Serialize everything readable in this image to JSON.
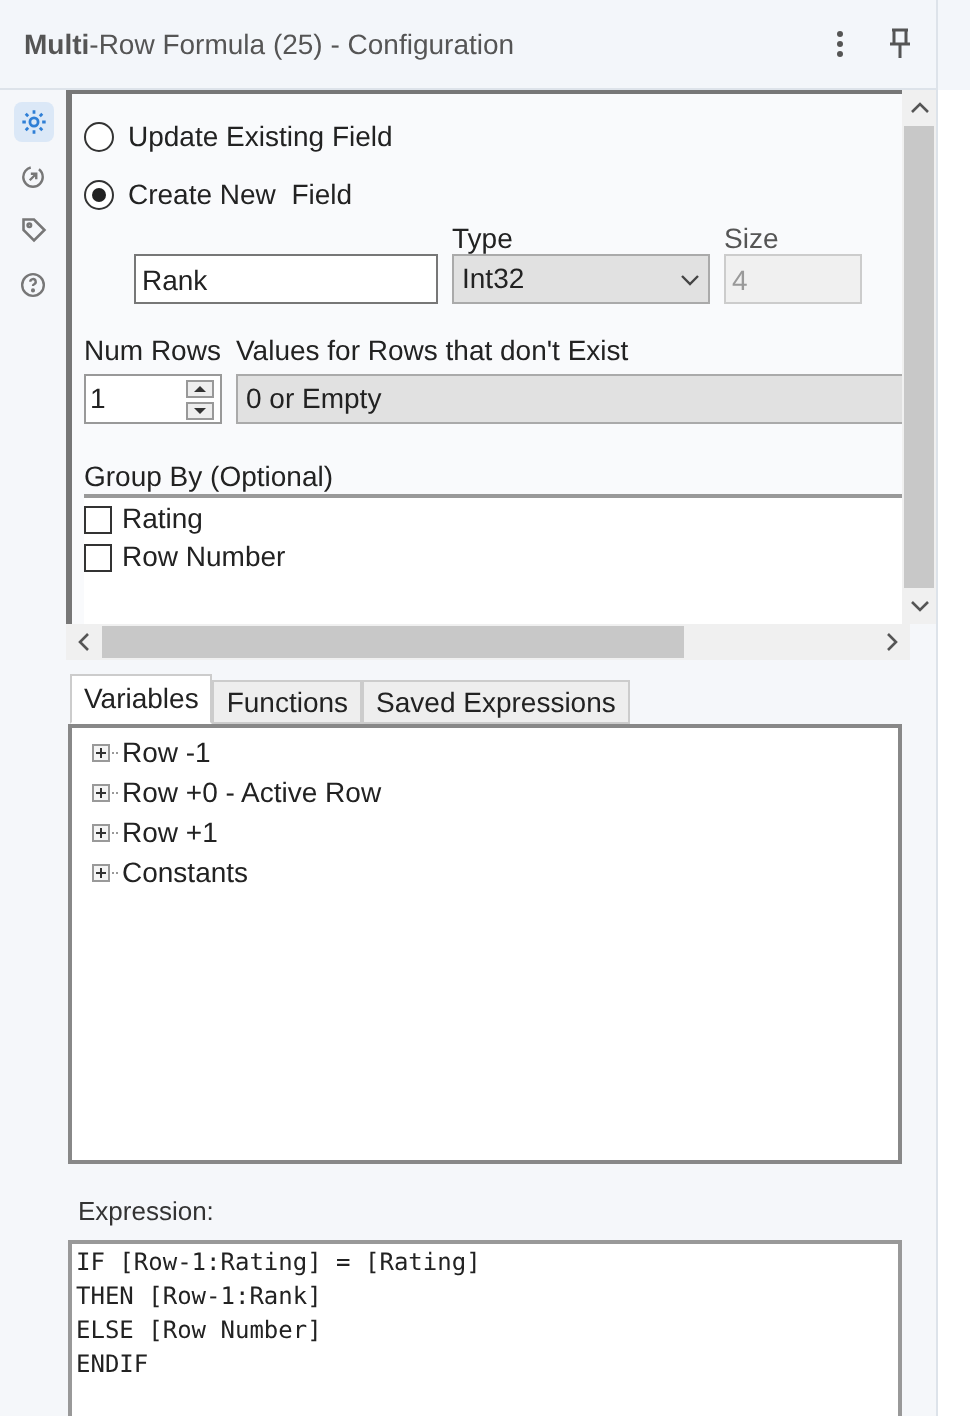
{
  "title": "**Multi**-Row Formula (25) - Configuration",
  "sidebar": {
    "items": [
      {
        "kind": "settings",
        "selected": true
      },
      {
        "kind": "connection",
        "selected": false
      },
      {
        "kind": "tag",
        "selected": false
      },
      {
        "kind": "help",
        "selected": false
      }
    ]
  },
  "mode_options": [
    {
      "label": "Update Existing Field",
      "selected": false
    },
    {
      "label": "Create New  Field",
      "selected": true
    }
  ],
  "new_field": {
    "name": "Rank",
    "type_label": "Type",
    "type": "Int32",
    "size_label": "Size",
    "size": "4"
  },
  "num_rows": {
    "label": "Num Rows",
    "value": "1"
  },
  "missing_rows": {
    "label": "Values for Rows that don't Exist",
    "value": "0 or Empty"
  },
  "group_by": {
    "label": "Group By (Optional)",
    "items": [
      {
        "label": "Rating",
        "checked": false
      },
      {
        "label": "Row Number",
        "checked": false
      }
    ]
  },
  "tabs": [
    {
      "label": "Variables",
      "selected": true
    },
    {
      "label": "Functions",
      "selected": false
    },
    {
      "label": "Saved Expressions",
      "selected": false
    }
  ],
  "variables": [
    {
      "label": "Row -1",
      "expanded": false
    },
    {
      "label": "Row +0 - Active Row",
      "expanded": false
    },
    {
      "label": "Row +1",
      "expanded": false
    },
    {
      "label": "Constants",
      "expanded": false
    }
  ],
  "expression": {
    "label": "Expression:",
    "lines": [
      "IF [Row-1:Rating] = [Rating]",
      "THEN [Row-1:Rank]",
      "ELSE [Row Number]",
      "ENDIF"
    ]
  }
}
